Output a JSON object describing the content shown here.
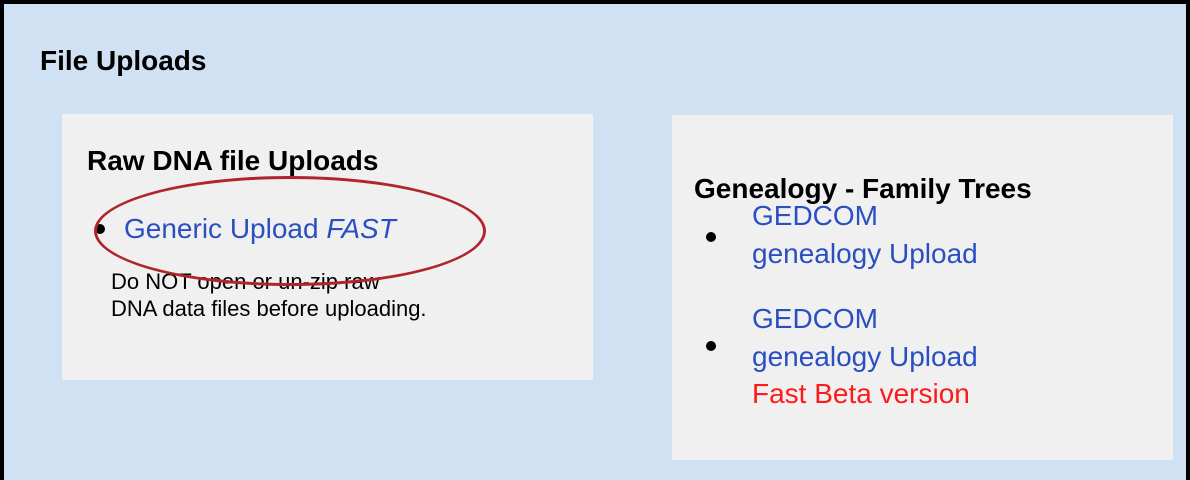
{
  "section": {
    "title": "File Uploads"
  },
  "raw_dna": {
    "title": "Raw DNA file Uploads",
    "link_text": "Generic Upload ",
    "link_emphasis": "FAST",
    "note_line1": "Do NOT open or un-zip raw",
    "note_line2": "DNA data files before uploading."
  },
  "genealogy": {
    "title": "Genealogy - Family Trees",
    "items": [
      {
        "line1": "GEDCOM",
        "line2": "genealogy Upload"
      },
      {
        "line1": "GEDCOM",
        "line2": "genealogy Upload",
        "extra": "Fast Beta version"
      }
    ]
  },
  "colors": {
    "background": "#cfe1f3",
    "card": "#f0f0f0",
    "link": "#2a4fc0",
    "beta": "#ff1a1a",
    "annotation": "#b0252c"
  }
}
